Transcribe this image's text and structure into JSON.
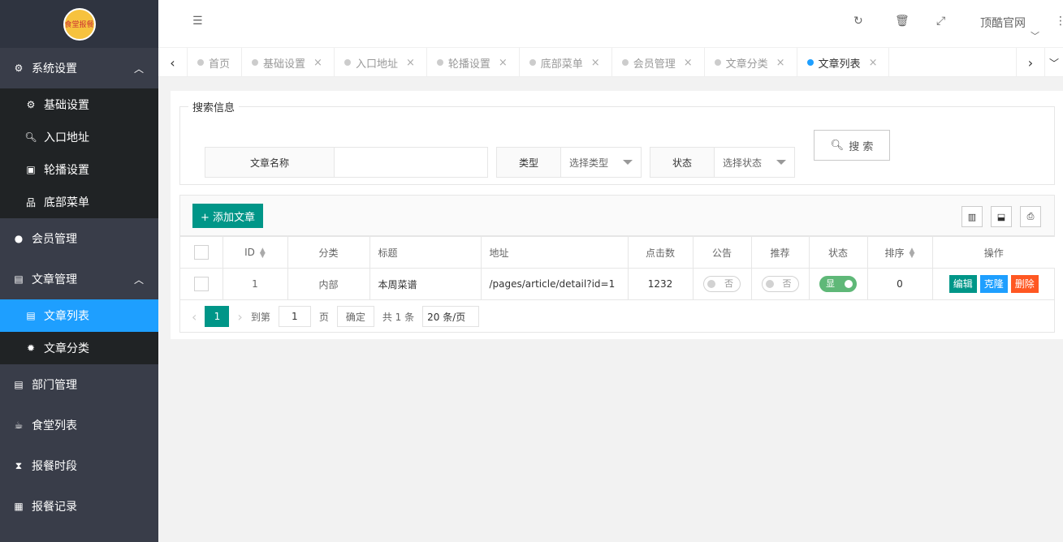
{
  "sidebar": {
    "logo_text": "食堂报餐",
    "groups": [
      {
        "label": "系统设置",
        "icon": "gears-icon",
        "arrow": "∧"
      },
      {
        "label": "会员管理",
        "icon": "user-icon"
      },
      {
        "label": "文章管理",
        "icon": "newspaper-icon",
        "arrow": "∧"
      },
      {
        "label": "部门管理",
        "icon": "list-icon"
      },
      {
        "label": "食堂列表",
        "icon": "cup-icon"
      },
      {
        "label": "报餐时段",
        "icon": "hourglass-icon"
      },
      {
        "label": "报餐记录",
        "icon": "table-icon"
      }
    ],
    "sys_sub": [
      "基础设置",
      "入口地址",
      "轮播设置",
      "底部菜单"
    ],
    "article_sub": [
      "文章列表",
      "文章分类"
    ]
  },
  "topbar": {
    "site_name": "顶酷官网"
  },
  "tabs": [
    "首页",
    "基础设置",
    "入口地址",
    "轮播设置",
    "底部菜单",
    "会员管理",
    "文章分类",
    "文章列表"
  ],
  "search": {
    "legend": "搜索信息",
    "name_label": "文章名称",
    "type_label": "类型",
    "type_placeholder": "选择类型",
    "status_label": "状态",
    "status_placeholder": "选择状态",
    "button": "搜 索"
  },
  "toolbar": {
    "add_label": "+ 添加文章"
  },
  "table": {
    "headers": [
      "ID",
      "分类",
      "标题",
      "地址",
      "点击数",
      "公告",
      "推荐",
      "状态",
      "排序",
      "操作"
    ],
    "rows": [
      {
        "id": "1",
        "category": "内部",
        "title": "本周菜谱",
        "url": "/pages/article/detail?id=1",
        "clicks": "1232",
        "notice": "否",
        "recommend": "否",
        "status": "显",
        "sort": "0"
      }
    ],
    "actions": {
      "edit": "编辑",
      "clone": "克隆",
      "delete": "删除"
    }
  },
  "pager": {
    "page": "1",
    "goto": "到第",
    "goto_value": "1",
    "page_unit": "页",
    "confirm": "确定",
    "total": "共 1 条",
    "per_page": "20 条/页"
  },
  "colors": {
    "sidebar": "#393d49",
    "active": "#1e9fff",
    "primary": "#009688",
    "danger": "#ff5722",
    "switch_on": "#5fb878"
  }
}
